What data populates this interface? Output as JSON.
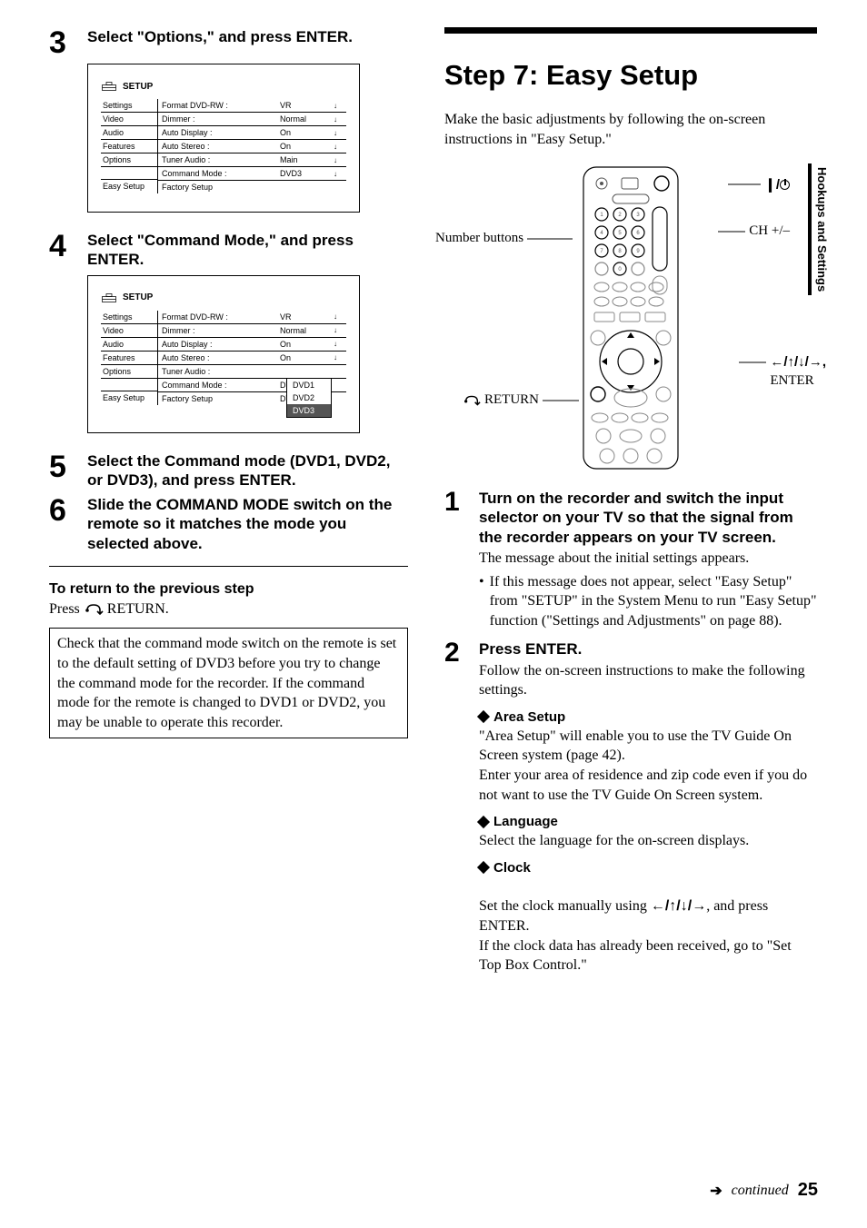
{
  "sidebar_tab": "Hookups and Settings",
  "page_number": "25",
  "continued": "continued",
  "left": {
    "steps": {
      "s3": {
        "num": "3",
        "title": "Select \"Options,\" and press ENTER."
      },
      "s4": {
        "num": "4",
        "title": "Select \"Command Mode,\" and press ENTER."
      },
      "s5": {
        "num": "5",
        "title": "Select the Command mode (DVD1, DVD2, or DVD3), and press ENTER."
      },
      "s6": {
        "num": "6",
        "title": "Slide the COMMAND MODE switch on the remote so it matches the mode you selected above."
      }
    },
    "setup1": {
      "header": "SETUP",
      "menu": [
        "Settings",
        "Video",
        "Audio",
        "Features",
        "Options",
        "",
        "Easy Setup"
      ],
      "opts": [
        {
          "label": "Format DVD-RW :",
          "val": "VR",
          "arr": "↓"
        },
        {
          "label": "Dimmer :",
          "val": "Normal",
          "arr": "↓"
        },
        {
          "label": "Auto Display :",
          "val": "On",
          "arr": "↓"
        },
        {
          "label": "Auto Stereo :",
          "val": "On",
          "arr": "↓"
        },
        {
          "label": "Tuner Audio :",
          "val": "Main",
          "arr": "↓"
        },
        {
          "label": "Command Mode :",
          "val": "DVD3",
          "arr": "↓"
        },
        {
          "label": "Factory Setup",
          "val": "",
          "arr": ""
        }
      ]
    },
    "setup2": {
      "header": "SETUP",
      "menu": [
        "Settings",
        "Video",
        "Audio",
        "Features",
        "Options",
        "",
        "Easy Setup"
      ],
      "opts": [
        {
          "label": "Format DVD-RW :",
          "val": "VR",
          "arr": "↓"
        },
        {
          "label": "Dimmer :",
          "val": "Normal",
          "arr": "↓"
        },
        {
          "label": "Auto Display :",
          "val": "On",
          "arr": "↓"
        },
        {
          "label": "Auto Stereo :",
          "val": "On",
          "arr": "↓"
        },
        {
          "label": "Tuner Audio :",
          "val": "",
          "arr": ""
        },
        {
          "label": "Command Mode :",
          "val": "DVD1",
          "arr": ""
        },
        {
          "label": "Factory Setup",
          "val": "DVD2",
          "arr": ""
        }
      ],
      "dropdown": [
        "DVD1",
        "DVD2",
        "DVD3"
      ]
    },
    "return_heading": "To return to the previous step",
    "return_body_prefix": "Press ",
    "return_body_suffix": " RETURN.",
    "note": "Check that the command mode switch on the remote is set to the default setting of DVD3 before you try to change the command mode for the recorder. If the command mode for the remote is changed to DVD1 or DVD2, you may be unable to operate this recorder."
  },
  "right": {
    "heading": "Step 7: Easy Setup",
    "intro": "Make the basic adjustments by following the on-screen instructions in \"Easy Setup.\"",
    "labels": {
      "number_buttons": "Number buttons",
      "return": "RETURN",
      "power": "",
      "ch": "CH +/–",
      "arrows": "←/↑/↓/→,",
      "enter": "ENTER"
    },
    "steps": {
      "s1": {
        "num": "1",
        "title": "Turn on the recorder and switch the input selector on your TV so that the signal from the recorder appears on your TV screen.",
        "body": "The message about the initial settings appears.",
        "bullet": "If this message does not appear, select \"Easy Setup\" from \"SETUP\" in the System Menu to run \"Easy Setup\" function (\"Settings and Adjustments\" on page 88)."
      },
      "s2": {
        "num": "2",
        "title": "Press ENTER.",
        "body": "Follow the on-screen instructions to make the following settings.",
        "area_h": "Area Setup",
        "area_b": "\"Area Setup\" will enable you to use the TV Guide On Screen system (page 42).\nEnter your area of residence and zip code even if you do not want to use the TV Guide On Screen system.",
        "lang_h": "Language",
        "lang_b": "Select the language for the on-screen displays.",
        "clock_h": "Clock",
        "clock_b1": "Set the clock manually using ",
        "clock_arrows": "←/↑/↓/→",
        "clock_b2": ", and press ENTER.\nIf the clock data has already been received, go to \"Set Top Box Control.\""
      }
    }
  }
}
